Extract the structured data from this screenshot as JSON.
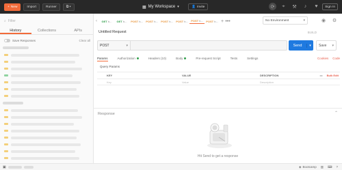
{
  "topbar": {
    "new_label": "New",
    "import_label": "Import",
    "runner_label": "Runner",
    "workspace_name": "My Workspace",
    "invite_label": "Invite",
    "upgrade_label": "Sign In"
  },
  "sidebar": {
    "search_placeholder": "Filter",
    "tabs": [
      "History",
      "Collections",
      "APIs"
    ],
    "save_responses": "Save Responses",
    "clear_all": "Clear all"
  },
  "request_tabs": [
    {
      "method": "GET",
      "name": "h..."
    },
    {
      "method": "GET",
      "name": "h..."
    },
    {
      "method": "POST",
      "name": "h..."
    },
    {
      "method": "POST",
      "name": "h..."
    },
    {
      "method": "POST",
      "name": "h..."
    },
    {
      "method": "POST",
      "name": "h..."
    },
    {
      "method": "POST",
      "name": "h..."
    },
    {
      "method": "POST",
      "name": "h..."
    }
  ],
  "environment": "No Environment",
  "request": {
    "title": "Untitled Request",
    "build_label": "BUILD",
    "method": "POST",
    "url": "",
    "send_label": "Send",
    "save_label": "Save"
  },
  "subtabs": {
    "params": "Params",
    "authorization": "Authorization",
    "headers": "Headers (10)",
    "body": "Body",
    "prerequest": "Pre-request Script",
    "tests": "Tests",
    "settings": "Settings",
    "cookies": "Cookies",
    "code": "Code"
  },
  "query_params": {
    "title": "Query Params",
    "headers": [
      "KEY",
      "VALUE",
      "DESCRIPTION"
    ],
    "more": "•••",
    "bulk_edit": "Bulk Edit",
    "row": {
      "key": "Key",
      "value": "Value",
      "description": "Description"
    }
  },
  "response": {
    "label": "Response",
    "hint": "Hit Send to get a response"
  },
  "statusbar": {
    "bootcamp": "Bootcamp"
  },
  "colors": {
    "accent": "#f26b3a",
    "send_blue": "#1f7ae0",
    "topbar": "#282828"
  }
}
